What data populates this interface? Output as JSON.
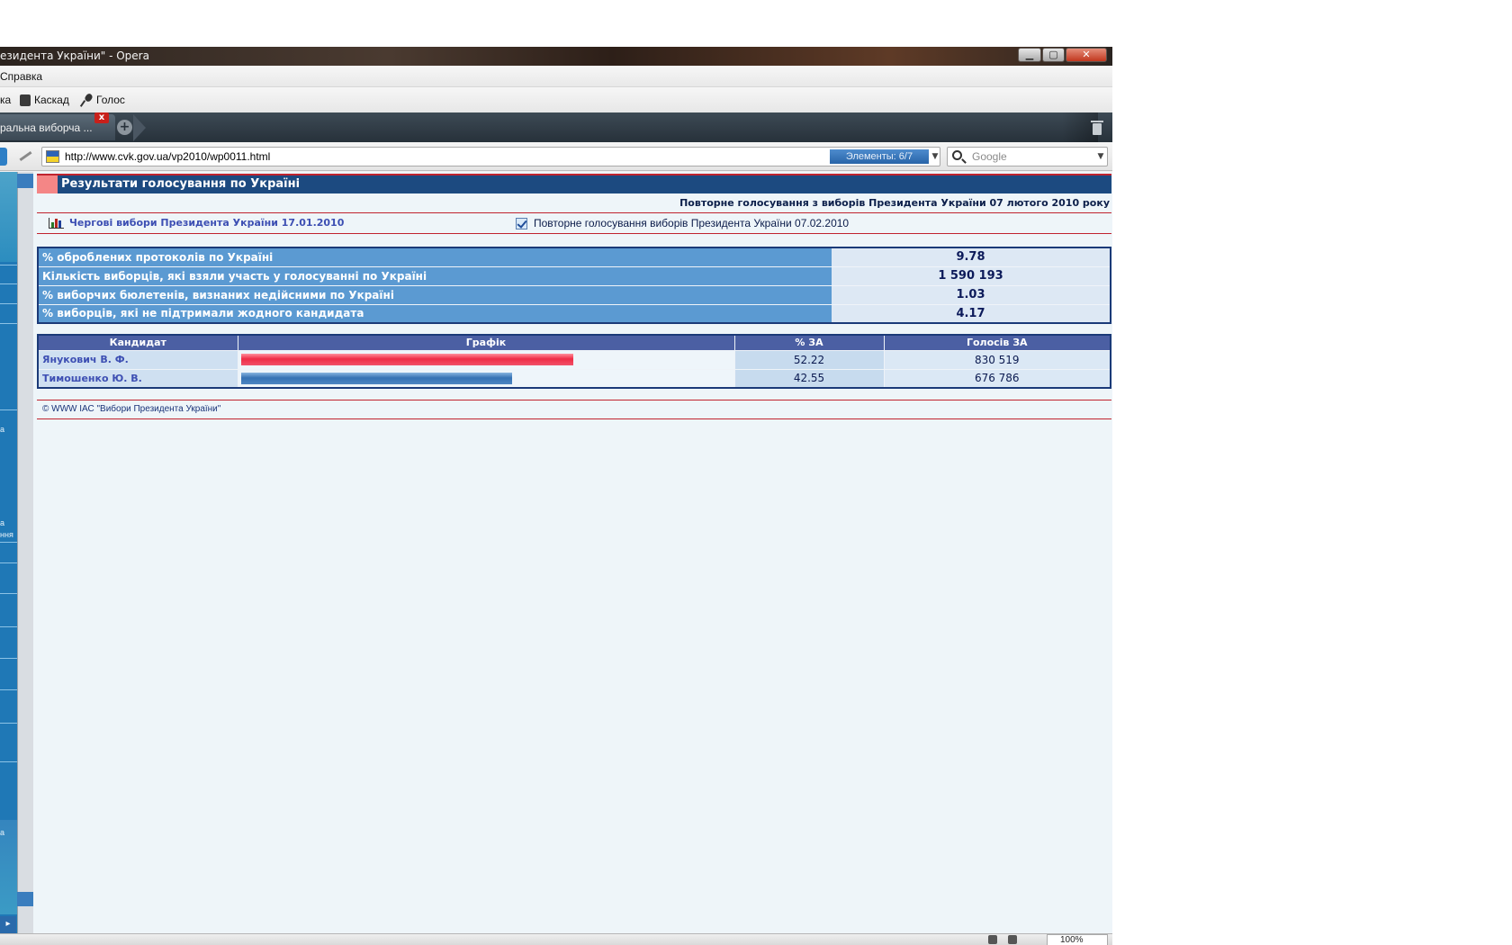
{
  "window": {
    "title": "езидента України\" - Opera",
    "minimize_label": "▁",
    "maximize_label": "▢",
    "close_label": "✕"
  },
  "menu": {
    "items": [
      "Справка"
    ]
  },
  "toolbar": {
    "items": [
      "ка",
      "Каскад",
      "Голос"
    ]
  },
  "tabs": {
    "active_label": "ральна виборча ...",
    "close_label": "x",
    "new_tab_label": "+"
  },
  "address": {
    "url": "http://www.cvk.gov.ua/vp2010/wp0011.html",
    "elements_badge": "Элементы:  6/7",
    "dropdown": "▼",
    "search_placeholder": "Google",
    "search_dropdown": "▼"
  },
  "left_panel": {
    "snippets": [
      "а",
      "а",
      "ння",
      "а"
    ],
    "scroll_arrow": "▸"
  },
  "page": {
    "header_title": "Результати голосування по Україні",
    "subtitle": "Повторне голосування з виборів Президента України 07 лютого 2010 року",
    "link_first_round": "Чергові вибори Президента України 17.01.2010",
    "link_second_round": "Повторне голосування виборів Президента України 07.02.2010",
    "stats": [
      {
        "label": "% оброблених протоколів по Україні",
        "value": "9.78"
      },
      {
        "label": "Кількість виборців, які взяли участь у голосуванні по Україні",
        "value": "1 590 193"
      },
      {
        "label": "% виборчих бюлетенів, визнаних недійсними по Україні",
        "value": "1.03"
      },
      {
        "label": "% виборців, які не підтримали жодного кандидата",
        "value": "4.17"
      }
    ],
    "candidates_table": {
      "headers": {
        "candidate": "Кандидат",
        "graph": "Графік",
        "percent": "% ЗА",
        "votes": "Голосів ЗА"
      },
      "rows": [
        {
          "name": "Янукович В. Ф.",
          "percent": "52.22",
          "votes": "830 519",
          "share": 0.6782,
          "color": "#ef2c45"
        },
        {
          "name": "Тимошенко Ю. В.",
          "percent": "42.55",
          "votes": "676 786",
          "share": 0.5526,
          "color": "#3672b4"
        }
      ]
    },
    "footer": "© WWW ІАС \"Вибори Президента України\""
  },
  "statusbar": {
    "zoom": "100%"
  }
}
